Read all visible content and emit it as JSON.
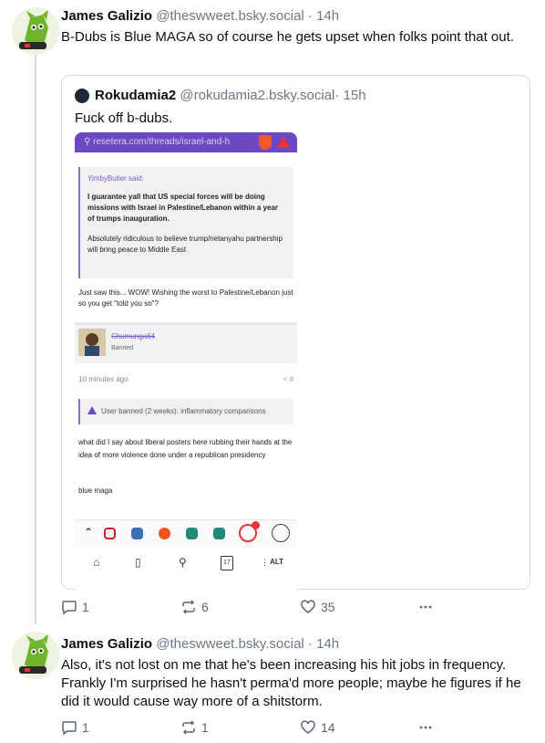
{
  "post1": {
    "display_name": "James Galizio",
    "handle": "@theswweet.bsky.social",
    "time": " · 14h",
    "text": "B-Dubs is Blue MAGA so of course he gets upset when folks point that out.",
    "quoted": {
      "display_name": "Rokudamia2",
      "handle": "@rokudamia2.bsky.social",
      "time": " · 15h",
      "text": "Fuck off b-dubs.",
      "screenshot": {
        "url": "resetera.com/threads/israel-and-h",
        "quote_author": "YimbyButler said:",
        "quote_bold": "I guarantee yall that US special forces will be doing missions with Israel in Palestine/Lebanon within a year of trumps inauguration.",
        "quote_rest": "Absolutely ridiculous to believe trump/netanyahu partnership will bring peace to Middle East",
        "reply1": "Just saw this... WOW! Wishing the worst to Palestine/Lebanon just so you get \"told you so\"?",
        "username": "Chumunga64",
        "user_status": "Banned",
        "time_ago": "10 minutes ago",
        "share_glyph": "< #",
        "ban_notice": "User banned (2 weeks): inflammatory comparisons",
        "reply2": "what did I say about liberal posters here rubbing their hands at the idea of more violence done under a republican presidency",
        "reply3": "blue maga",
        "tab_count": "17",
        "alt": "ALT"
      }
    },
    "replies": "1",
    "reposts": "6",
    "likes": "35"
  },
  "post2": {
    "display_name": "James Galizio",
    "handle": "@theswweet.bsky.social",
    "time": " · 14h",
    "text": "Also, it's not lost on me that he's been increasing his hit jobs in frequency. Frankly I'm surprised he hasn't perma'd more people; maybe he figures if he did it would cause way more of a shitstorm.",
    "replies": "1",
    "reposts": "1",
    "likes": "14"
  },
  "icons": {
    "reply": "speech-bubble-icon",
    "repost": "repost-arrows-icon",
    "like": "heart-icon",
    "more": "more-dots-icon"
  },
  "colors": {
    "accent": "#6c48c5",
    "name": "#0b0f14",
    "muted": "#6b7785",
    "border": "#d4dbe2"
  }
}
